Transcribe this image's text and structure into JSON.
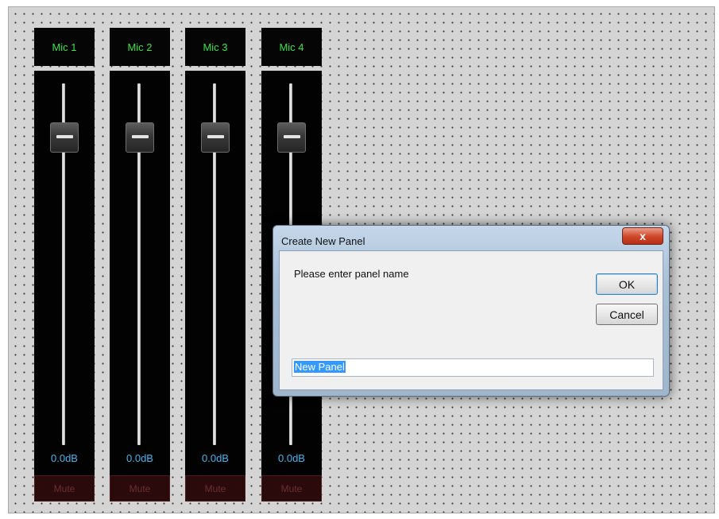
{
  "strips": [
    {
      "name": "Mic 1",
      "level": "0.0dB",
      "mute": "Mute"
    },
    {
      "name": "Mic 2",
      "level": "0.0dB",
      "mute": "Mute"
    },
    {
      "name": "Mic 3",
      "level": "0.0dB",
      "mute": "Mute"
    },
    {
      "name": "Mic 4",
      "level": "0.0dB",
      "mute": "Mute"
    }
  ],
  "dialog": {
    "title": "Create New Panel",
    "close_label": "x",
    "prompt": "Please enter panel name",
    "ok_label": "OK",
    "cancel_label": "Cancel",
    "input_value": "New Panel"
  },
  "colors": {
    "strip_name_text": "#3de24a",
    "level_text": "#49b4ee",
    "mute_bg": "#2a0a0a",
    "close_button": "#c84328",
    "selection": "#3399ff"
  },
  "icons": {
    "fader": "fader-handle-icon",
    "close": "close-icon"
  }
}
